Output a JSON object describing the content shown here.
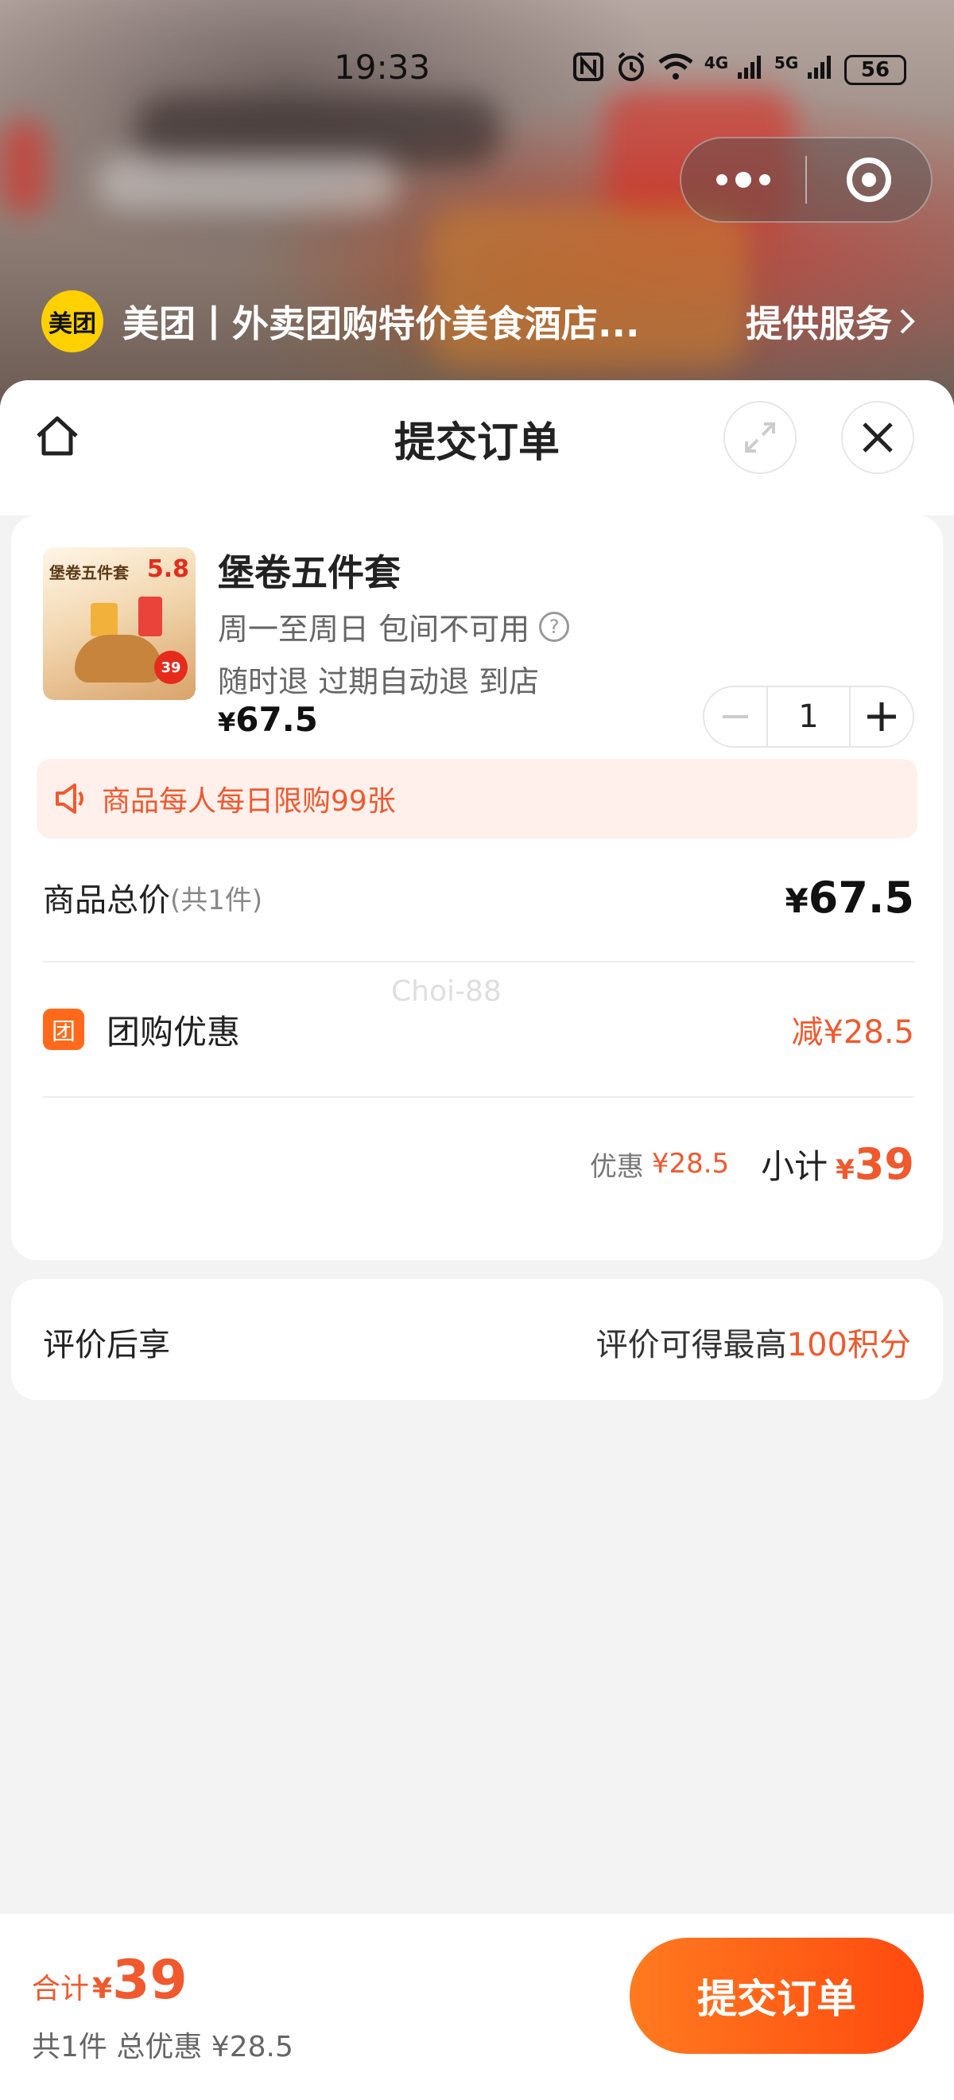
{
  "status_bar": {
    "time": "19:33",
    "icons": [
      "nfc-icon",
      "alarm-icon",
      "wifi-icon",
      "4g-signal-icon",
      "5g-signal-icon"
    ],
    "signal_4g": "4G",
    "signal_5g": "5G",
    "battery": "56"
  },
  "capsule": {
    "more_icon": "more-dots-icon",
    "close_icon": "miniprogram-close-icon"
  },
  "provider": {
    "logo_text": "美团",
    "name": "美团丨外卖团购特价美食酒店...",
    "link": "提供服务"
  },
  "sheet": {
    "title": "提交订单",
    "home_icon": "home-icon",
    "expand_icon": "expand-icon",
    "close_icon": "close-icon"
  },
  "product": {
    "image_text": "堡卷五件套",
    "image_badge": "5.8",
    "image_round": "39",
    "name": "堡卷五件套",
    "usage": "周一至周日 包间不可用",
    "help_icon": "question-icon",
    "refund": "随时退 过期自动退 到店",
    "currency": "¥",
    "price": "67.5",
    "quantity": "1",
    "minus": "−",
    "plus": "+"
  },
  "limit_notice": {
    "icon": "speaker-icon",
    "text": "商品每人每日限购99张"
  },
  "summary": {
    "total_label": "商品总价",
    "total_count": "(共1件)",
    "total_currency": "¥",
    "total_value": "67.5",
    "watermark": "Choi-88",
    "group_icon_text": "团",
    "group_label": "团购优惠",
    "group_value": "减¥28.5",
    "discount_label": "优惠",
    "discount_value": "¥28.5",
    "subtotal_label": "小计",
    "subtotal_currency": "¥",
    "subtotal_value": "39"
  },
  "review": {
    "label": "评价后享",
    "prefix": "评价可得最高",
    "highlight": "100积分"
  },
  "bottom": {
    "total_label": "合计",
    "currency": "¥",
    "total_value": "39",
    "sub": "共1件 总优惠 ¥28.5",
    "submit": "提交订单"
  },
  "colors": {
    "accent": "#f0592d",
    "button_start": "#ff7a1f",
    "button_end": "#ff4a0f",
    "meituan_yellow": "#ffd100"
  }
}
